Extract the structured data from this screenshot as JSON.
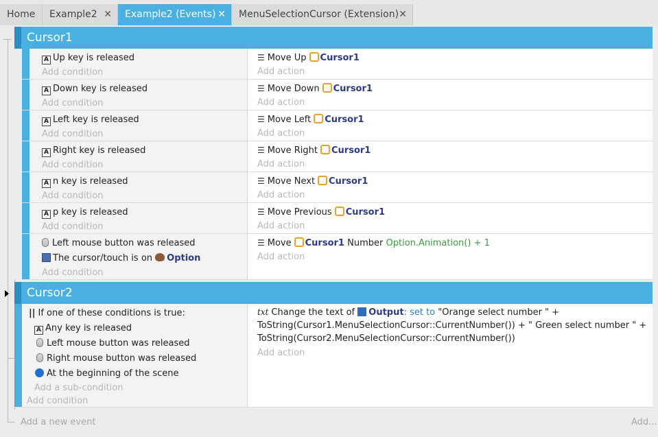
{
  "tabs": [
    {
      "label": "Home",
      "closable": false,
      "active": false
    },
    {
      "label": "Example2",
      "closable": true,
      "active": false
    },
    {
      "label": "Example2 (Events)",
      "closable": true,
      "active": true
    },
    {
      "label": "MenuSelectionCursor (Extension)",
      "closable": true,
      "active": false
    }
  ],
  "close_glyph": "✕",
  "placeholders": {
    "add_condition": "Add condition",
    "add_action": "Add action",
    "add_sub_condition": "Add a sub-condition",
    "add_new_event": "Add a new event",
    "add_more": "Add..."
  },
  "groups": [
    {
      "title": "Cursor1",
      "events": [
        {
          "key": "Up",
          "suffix": "key is released",
          "action": "Move Up",
          "object": "Cursor1"
        },
        {
          "key": "Down",
          "suffix": "key is released",
          "action": "Move Down",
          "object": "Cursor1"
        },
        {
          "key": "Left",
          "suffix": "key is released",
          "action": "Move Left",
          "object": "Cursor1"
        },
        {
          "key": "Right",
          "suffix": "key is released",
          "action": "Move Right",
          "object": "Cursor1"
        },
        {
          "key": "n",
          "suffix": "key is released",
          "action": "Move Next",
          "object": "Cursor1"
        },
        {
          "key": "p",
          "suffix": "key is released",
          "action": "Move Previous",
          "object": "Cursor1"
        }
      ],
      "mouse_event": {
        "cond1": "Left mouse button was released",
        "cond2_prefix": "The cursor/touch is on",
        "cond2_object": "Option",
        "action_verb": "Move",
        "action_object": "Cursor1",
        "action_param_label": "Number",
        "action_param_value": "Option.Animation() + 1"
      }
    },
    {
      "title": "Cursor2",
      "or_event": {
        "header": "If one of these conditions is true:",
        "subconditions": [
          "Any key is released",
          "Left mouse button was released",
          "Right mouse button was released",
          "At the beginning of the scene"
        ],
        "action_prefix": "Change the text of",
        "action_object": "Output",
        "action_op": "set to",
        "action_lines": [
          "\"Orange select number \" +",
          "ToString(Cursor1.MenuSelectionCursor::CurrentNumber()) + \" Green select number \" +",
          "ToString(Cursor2.MenuSelectionCursor::CurrentNumber())"
        ]
      }
    }
  ],
  "colors": {
    "accent": "#4ab0e2",
    "object_name": "#2d3a8c",
    "expression_green": "#3a9a3a",
    "object_icon_orange": "#e8a12a"
  },
  "icons": {
    "key": "key-icon",
    "mouse": "mouse-icon",
    "action_list": "list-icon",
    "object": "object-icon",
    "cursor_touch": "cursor-icon",
    "scene": "scene-start-icon",
    "text": "text-icon",
    "or": "or-icon"
  }
}
